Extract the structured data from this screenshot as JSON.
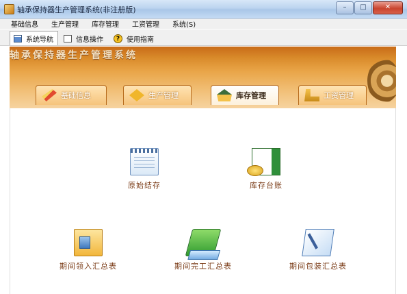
{
  "window": {
    "title": "轴承保持器生产管理系统(非注册版)",
    "buttons": {
      "minimize": "–",
      "maximize": "□",
      "close": "✕"
    }
  },
  "menubar": {
    "items": [
      {
        "label": "基础信息"
      },
      {
        "label": "生产管理"
      },
      {
        "label": "库存管理"
      },
      {
        "label": "工资管理"
      },
      {
        "label": "系统(S)"
      }
    ]
  },
  "toolbar": {
    "tabs": [
      {
        "label": "系统导航",
        "icon": "navigation-icon",
        "active": true
      },
      {
        "label": "信息操作",
        "icon": "info-icon",
        "active": false
      },
      {
        "label": "使用指南",
        "icon": "help-icon",
        "active": false
      }
    ],
    "help_glyph": "?"
  },
  "banner": {
    "title": "轴承保持器生产管理系统",
    "tabs": [
      {
        "label": "基础信息",
        "icon": "pencil-icon",
        "active": false
      },
      {
        "label": "生产管理",
        "icon": "production-icon",
        "active": false
      },
      {
        "label": "库存管理",
        "icon": "house-icon",
        "active": true
      },
      {
        "label": "工资管理",
        "icon": "wage-icon",
        "active": false
      }
    ]
  },
  "modules": [
    {
      "label": "原始结存",
      "icon": "calendar-icon"
    },
    {
      "label": "库存台账",
      "icon": "ledger-coins-icon"
    },
    {
      "label": "期间领入汇总表",
      "icon": "inbound-document-icon"
    },
    {
      "label": "期间完工汇总表",
      "icon": "folder-icon"
    },
    {
      "label": "期间包装汇总表",
      "icon": "packaging-icon"
    }
  ],
  "colors": {
    "banner_orange": "#d98a2a",
    "module_label": "#7a3b16",
    "titlebar_blue": "#bcd4ef"
  }
}
